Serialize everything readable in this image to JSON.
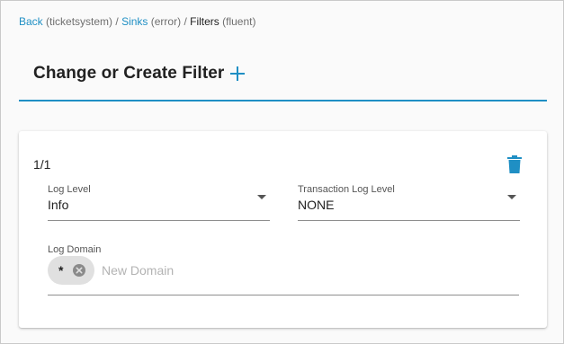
{
  "breadcrumb": {
    "back_label": "Back",
    "back_context": "(ticketsystem)",
    "sep1": "/",
    "sinks_label": "Sinks",
    "sinks_context": "(error)",
    "sep2": "/",
    "filters_label": "Filters",
    "filters_context": "(fluent)"
  },
  "header": {
    "title": "Change or Create Filter",
    "add_icon": "plus-icon"
  },
  "colors": {
    "accent": "#1f8fc4",
    "text": "#212121",
    "chip_bg": "#e0e0e0"
  },
  "filter_card": {
    "counter": "1/1",
    "delete_icon": "trash-icon",
    "log_level": {
      "label": "Log Level",
      "value": "Info"
    },
    "transaction_log_level": {
      "label": "Transaction Log Level",
      "value": "NONE"
    },
    "log_domain": {
      "label": "Log Domain",
      "chips": [
        "*"
      ],
      "placeholder": "New Domain",
      "value": ""
    }
  }
}
